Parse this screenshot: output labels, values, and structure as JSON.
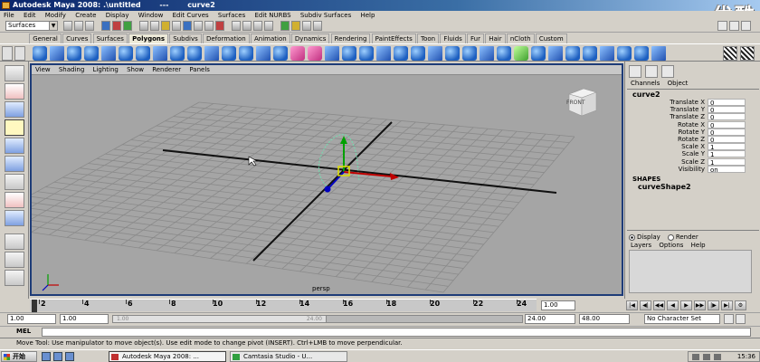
{
  "window": {
    "title": "Autodesk Maya 2008: .\\untitled",
    "title_sep": "---",
    "title_object": "curve2",
    "watermark": "优酷"
  },
  "menubar": [
    "File",
    "Edit",
    "Modify",
    "Create",
    "Display",
    "Window",
    "Edit Curves",
    "Surfaces",
    "Edit NURBS",
    "Subdiv Surfaces",
    "Help"
  ],
  "statusline": {
    "mode": "Surfaces"
  },
  "shelf_tabs": [
    "General",
    "Curves",
    "Surfaces",
    "Polygons",
    "Subdivs",
    "Deformation",
    "Animation",
    "Dynamics",
    "Rendering",
    "PaintEffects",
    "Toon",
    "Fluids",
    "Fur",
    "Hair",
    "nCloth",
    "Custom"
  ],
  "shelf_active_tab": "Polygons",
  "viewport": {
    "menu": [
      "View",
      "Shading",
      "Lighting",
      "Show",
      "Renderer",
      "Panels"
    ],
    "camera_label": "persp",
    "viewcube_face": "FRONT",
    "background": "#a5a5a5",
    "border_color": "#1e3c78"
  },
  "channel_box": {
    "tabs": [
      "Channels",
      "Object"
    ],
    "object_name": "curve2",
    "attributes": [
      {
        "label": "Translate X",
        "value": "0"
      },
      {
        "label": "Translate Y",
        "value": "0"
      },
      {
        "label": "Translate Z",
        "value": "0"
      },
      {
        "label": "Rotate X",
        "value": "0"
      },
      {
        "label": "Rotate Y",
        "value": "0"
      },
      {
        "label": "Rotate Z",
        "value": "0"
      },
      {
        "label": "Scale X",
        "value": "1"
      },
      {
        "label": "Scale Y",
        "value": "1"
      },
      {
        "label": "Scale Z",
        "value": "1"
      },
      {
        "label": "Visibility",
        "value": "on"
      }
    ],
    "shapes_header": "SHAPES",
    "shape_name": "curveShape2"
  },
  "layer_editor": {
    "display_label": "Display",
    "render_label": "Render",
    "menu": [
      "Layers",
      "Options",
      "Help"
    ]
  },
  "timeslider": {
    "ticks": [
      "2",
      "4",
      "6",
      "8",
      "10",
      "12",
      "14",
      "16",
      "18",
      "20",
      "22",
      "24"
    ],
    "current_frame": "1.00"
  },
  "range": {
    "start": "1.00",
    "current": "1.00",
    "inner_start": "1.00",
    "inner_end": "24.00",
    "end_time": "24.00",
    "end_range": "48.00",
    "character_set": "No Character Set"
  },
  "mel": {
    "label": "MEL"
  },
  "help_line": "Move Tool: Use manipulator to move object(s). Use edit mode to change pivot (INSERT). Ctrl+LMB to move perpendicular.",
  "taskbar": {
    "start_label": "开始",
    "buttons": [
      "Autodesk Maya 2008: ...",
      "Camtasia Studio - U..."
    ],
    "clock": "15:36"
  }
}
